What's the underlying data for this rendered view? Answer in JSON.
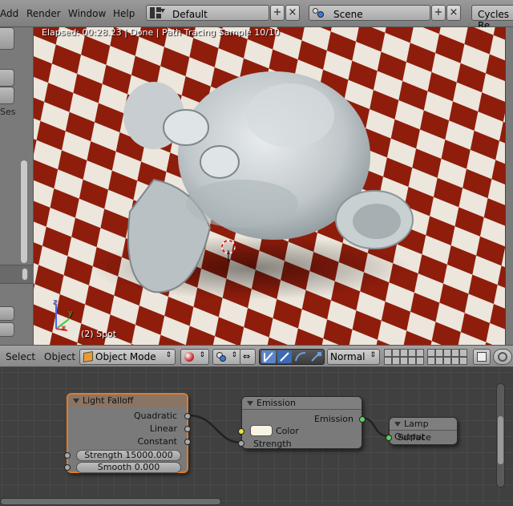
{
  "topbar": {
    "menus": [
      "Add",
      "Render",
      "Window",
      "Help"
    ],
    "layout_value": "Default",
    "scene_value": "Scene",
    "engine_value": "Cycles Re"
  },
  "left_shelf": {
    "label_fragment": "Ses"
  },
  "viewport": {
    "render_status": "Elapsed: 00:28.23 | Done | Path Tracing Sample 10/10",
    "object_label": "(2) Spot",
    "axis_labels": {
      "x": "x",
      "y": "y",
      "z": "z"
    },
    "colors": {
      "checker_red": "#8f1d0c",
      "checker_white": "#ece6dc"
    }
  },
  "header3d": {
    "select_label": "Select",
    "object_label": "Object",
    "mode_value": "Object Mode",
    "orientation_value": "Normal"
  },
  "nodes": {
    "light_falloff": {
      "title": "Light Falloff",
      "outputs": [
        "Quadratic",
        "Linear",
        "Constant"
      ],
      "strength_field": "Strength 15000.000",
      "smooth_field": "Smooth 0.000"
    },
    "emission": {
      "title": "Emission",
      "output": "Emission",
      "color_label": "Color",
      "strength_label": "Strength"
    },
    "lamp_output": {
      "title": "Lamp Output",
      "input": "Surface"
    },
    "colors": {
      "socket_gray": "#a8a8a8",
      "socket_yellow": "#e8e23a",
      "socket_green": "#5ad45a",
      "active_border": "#e07b2a"
    }
  }
}
